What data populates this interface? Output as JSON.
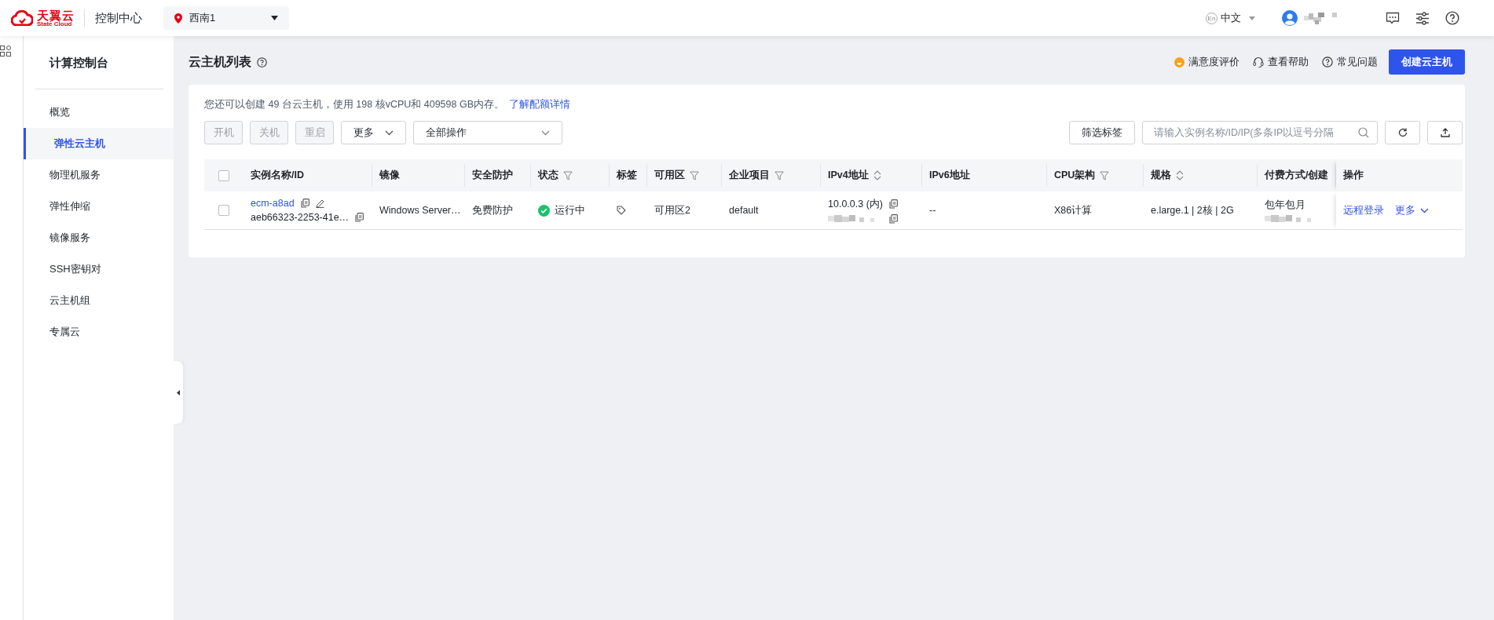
{
  "header": {
    "logo_text": "天翼云",
    "logo_subtext": "State Cloud",
    "title": "控制中心",
    "region": "西南1",
    "language_badge": "En",
    "language": "中文"
  },
  "sidebar": {
    "title": "计算控制台",
    "items": [
      {
        "label": "概览",
        "selected": false
      },
      {
        "label": "弹性云主机",
        "selected": true
      },
      {
        "label": "物理机服务",
        "selected": false
      },
      {
        "label": "弹性伸缩",
        "selected": false
      },
      {
        "label": "镜像服务",
        "selected": false
      },
      {
        "label": "SSH密钥对",
        "selected": false
      },
      {
        "label": "云主机组",
        "selected": false
      },
      {
        "label": "专属云",
        "selected": false
      }
    ]
  },
  "page": {
    "title": "云主机列表",
    "links": [
      {
        "label": "满意度评价",
        "kind": "smiley"
      },
      {
        "label": "查看帮助",
        "kind": "headset"
      },
      {
        "label": "常见问题",
        "kind": "question"
      }
    ],
    "create_button": "创建云主机"
  },
  "quota": {
    "text": "您还可以创建 49 台云主机，使用 198 核vCPU和 409598 GB内存。",
    "link": "了解配额详情"
  },
  "toolbar": {
    "buttons": [
      {
        "label": "开机",
        "disabled": true
      },
      {
        "label": "关机",
        "disabled": true
      },
      {
        "label": "重启",
        "disabled": true
      }
    ],
    "more": "更多",
    "batch_select": "全部操作",
    "tag_filter": "筛选标签",
    "search_placeholder": "请输入实例名称/ID/IP(多条IP以逗号分隔"
  },
  "table": {
    "select_all": {
      "checked": false
    },
    "columns": [
      {
        "label": "实例名称/ID"
      },
      {
        "label": "镜像"
      },
      {
        "label": "安全防护"
      },
      {
        "label": "状态",
        "filterable": true
      },
      {
        "label": "标签"
      },
      {
        "label": "可用区",
        "filterable": true
      },
      {
        "label": "企业项目",
        "filterable": true
      },
      {
        "label": "IPv4地址",
        "sortable": true
      },
      {
        "label": "IPv6地址"
      },
      {
        "label": "CPU架构",
        "filterable": true
      },
      {
        "label": "规格",
        "sortable": true
      },
      {
        "label": "付费方式/创建"
      },
      {
        "label": "操作"
      }
    ],
    "rows": [
      {
        "checked": false,
        "name": "ecm-a8ad",
        "id": "aeb66323-2253-41e…",
        "image": "Windows Server…",
        "protection": "免费防护",
        "status": {
          "label": "运行中",
          "kind": "running"
        },
        "zone": "可用区2",
        "project": "default",
        "ipv4": "10.0.0.3 (内)",
        "ipv6": "--",
        "cpu": "X86计算",
        "spec": "e.large.1 | 2核 | 2G",
        "billing": "包年包月",
        "actions": [
          "远程登录",
          "更多"
        ]
      }
    ]
  }
}
